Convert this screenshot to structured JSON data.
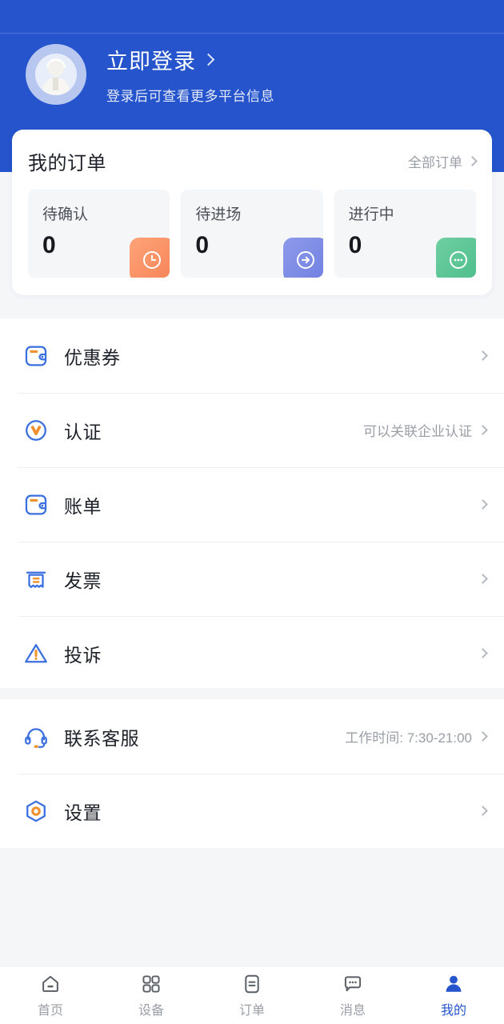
{
  "theme": {
    "primary": "#2554cc",
    "page_bg": "#f5f6f8",
    "card_bg": "#ffffff",
    "muted_text": "#9a9ea6",
    "accent_orange": "#f58357",
    "accent_purple": "#6f7fe0",
    "accent_green": "#4bbd8b"
  },
  "header": {
    "avatar_icon": "user-avatar-placeholder-icon",
    "login_title": "立即登录",
    "login_chevron_icon": "chevron-right-icon",
    "login_subtitle": "登录后可查看更多平台信息"
  },
  "orders": {
    "title": "我的订单",
    "all_orders_label": "全部订单",
    "all_orders_chevron_icon": "chevron-right-icon",
    "stats": [
      {
        "label": "待确认",
        "value": "0",
        "badge_icon": "clock-icon",
        "badge_color": "#f58357"
      },
      {
        "label": "待进场",
        "value": "0",
        "badge_icon": "arrow-right-circle-icon",
        "badge_color": "#6f7fe0"
      },
      {
        "label": "进行中",
        "value": "0",
        "badge_icon": "ellipsis-circle-icon",
        "badge_color": "#4bbd8b"
      }
    ]
  },
  "menu_group_a": [
    {
      "label": "优惠券",
      "icon": "wallet-icon",
      "hint": "",
      "chevron_icon": "chevron-right-icon"
    },
    {
      "label": "认证",
      "icon": "verified-badge-icon",
      "hint": "可以关联企业认证",
      "chevron_icon": "chevron-right-icon"
    },
    {
      "label": "账单",
      "icon": "wallet-icon",
      "hint": "",
      "chevron_icon": "chevron-right-icon"
    },
    {
      "label": "发票",
      "icon": "receipt-icon",
      "hint": "",
      "chevron_icon": "chevron-right-icon"
    },
    {
      "label": "投诉",
      "icon": "warning-triangle-icon",
      "hint": "",
      "chevron_icon": "chevron-right-icon"
    }
  ],
  "menu_group_b": [
    {
      "label": "联系客服",
      "icon": "headset-icon",
      "hint": "工作时间: 7:30-21:00",
      "chevron_icon": "chevron-right-icon"
    },
    {
      "label": "设置",
      "icon": "settings-hexagon-icon",
      "hint": "",
      "chevron_icon": "chevron-right-icon"
    }
  ],
  "tabbar": {
    "active_index": 4,
    "tabs": [
      {
        "label": "首页",
        "icon": "home-icon"
      },
      {
        "label": "设备",
        "icon": "grid-icon"
      },
      {
        "label": "订单",
        "icon": "order-doc-icon"
      },
      {
        "label": "消息",
        "icon": "chat-bubble-icon"
      },
      {
        "label": "我的",
        "icon": "person-icon"
      }
    ]
  }
}
